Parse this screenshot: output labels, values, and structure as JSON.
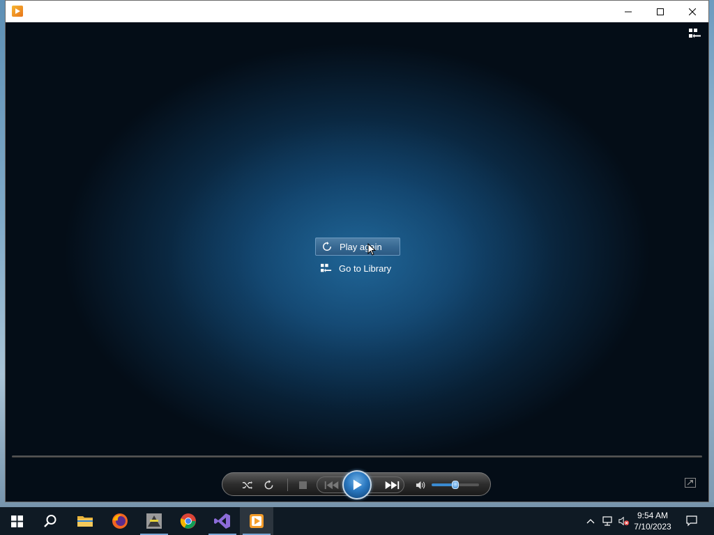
{
  "window": {
    "title": "",
    "app_icon": "media-player-icon",
    "controls": [
      "minimize-icon",
      "maximize-icon",
      "close-icon"
    ]
  },
  "player": {
    "switch_icon": "switch-to-library-icon",
    "menu": {
      "play_again": "Play again",
      "go_to_library": "Go to Library"
    },
    "controls": {
      "shuffle_icon": "shuffle-icon",
      "repeat_icon": "repeat-icon",
      "stop_icon": "stop-icon",
      "previous_icon": "previous-icon",
      "play_icon": "play-icon",
      "next_icon": "next-icon",
      "mute_icon": "volume-icon",
      "volume_level": 0.5,
      "fullscreen_icon": "fullscreen-icon"
    }
  },
  "taskbar": {
    "apps": [
      {
        "name": "start",
        "icon": "windows-icon"
      },
      {
        "name": "search",
        "icon": "search-icon"
      },
      {
        "name": "file-explorer",
        "icon": "folder-icon"
      },
      {
        "name": "firefox",
        "icon": "firefox-icon"
      },
      {
        "name": "app",
        "icon": "app-icon"
      },
      {
        "name": "chrome",
        "icon": "chrome-icon"
      },
      {
        "name": "visual-studio",
        "icon": "visual-studio-icon"
      },
      {
        "name": "media-player",
        "icon": "media-player-icon"
      }
    ],
    "clock": {
      "time": "9:54 AM",
      "date": "7/10/2023"
    }
  },
  "colors": {
    "accent": "#2a78c0",
    "taskbar": "#0f1a24"
  }
}
